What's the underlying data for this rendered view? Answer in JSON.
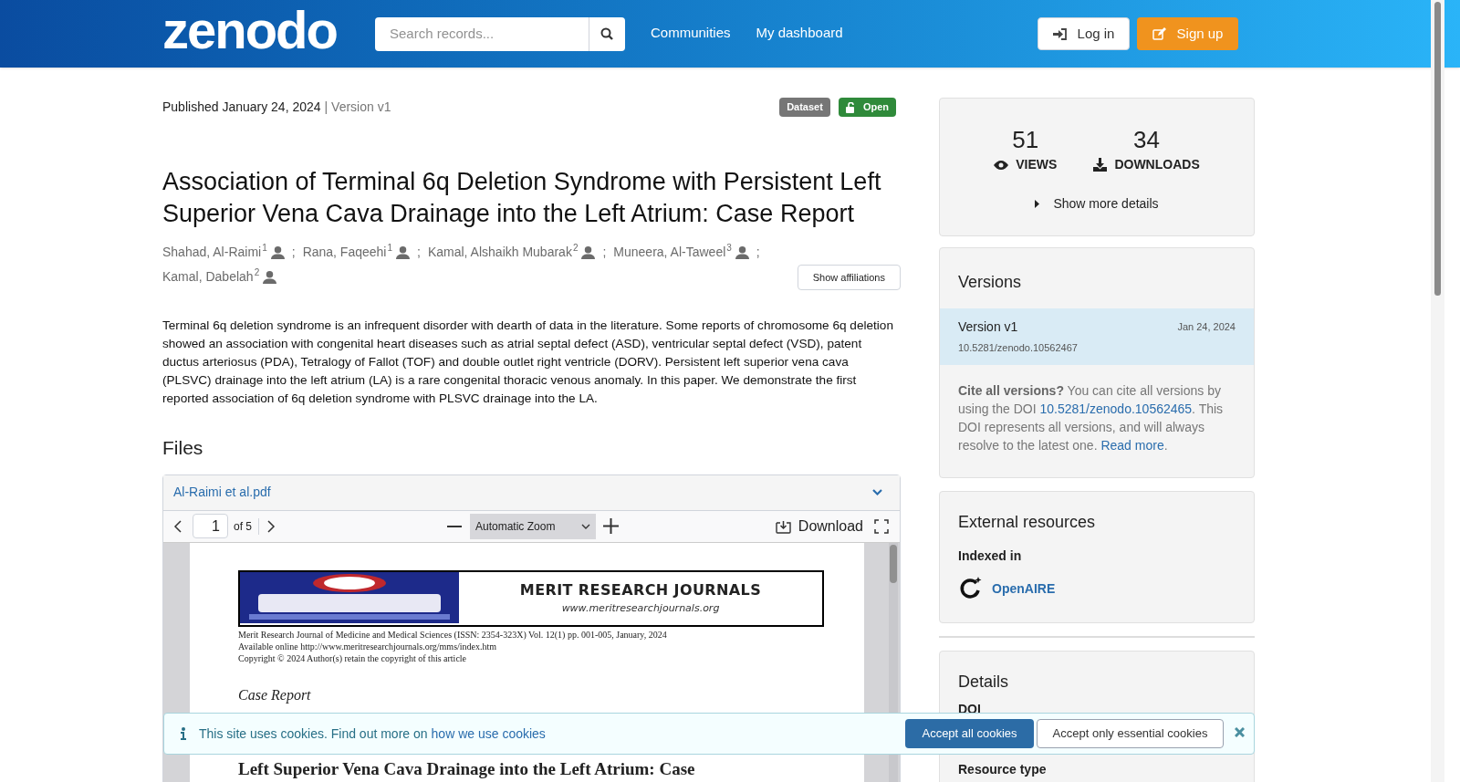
{
  "header": {
    "logo": "zenodo",
    "search": {
      "placeholder": "Search records..."
    },
    "nav": [
      "Communities",
      "My dashboard"
    ],
    "login": "Log in",
    "signup": "Sign up"
  },
  "record": {
    "published": "Published January 24, 2024",
    "version": "| Version v1",
    "badges": [
      {
        "label": "Dataset",
        "kind": "type"
      },
      {
        "label": "Open",
        "kind": "access"
      }
    ],
    "title": "Association of Terminal 6q Deletion Syndrome with Persistent Left Superior Vena Cava Drainage into the Left Atrium: Case Report",
    "authors": [
      {
        "name": "Shahad, Al-Raimi",
        "aff": "1"
      },
      {
        "name": "Rana, Faqeehi",
        "aff": "1"
      },
      {
        "name": "Kamal, Alshaikh Mubarak",
        "aff": "2"
      },
      {
        "name": "Muneera, Al-Taweel",
        "aff": "3"
      },
      {
        "name": "Kamal, Dabelah",
        "aff": "2"
      }
    ],
    "separator": ";",
    "show_affiliations": "Show affiliations",
    "abstract": "Terminal 6q deletion syndrome is an infrequent disorder with dearth of data in the literature. Some reports of chromosome 6q deletion showed an association with congenital heart diseases such as atrial septal defect (ASD), ventricular septal defect (VSD), patent ductus arteriosus (PDA), Tetralogy of Fallot (TOF) and double outlet right ventricle (DORV). Persistent left superior vena cava (PLSVC) drainage into the left atrium (LA) is a rare congenital thoracic venous anomaly. In this paper. We demonstrate the first reported association of 6q deletion syndrome with PLSVC drainage into the LA."
  },
  "files": {
    "heading": "Files",
    "filename": "Al-Raimi et al.pdf",
    "expanded": true,
    "viewer": {
      "page": "1",
      "of": "of 5",
      "zoom": "Automatic Zoom",
      "download": "Download",
      "document": {
        "banner_title": "MERIT RESEARCH JOURNALS",
        "banner_url": "www.meritresearchjournals.org",
        "lines": [
          "Merit Research Journal of Medicine and Medical Sciences (ISSN: 2354-323X) Vol. 12(1) pp. 001-005, January, 2024",
          "Available online http://www.meritresearchjournals.org/mms/index.htm",
          "Copyright © 2024 Author(s) retain the copyright of this article"
        ],
        "section": "Case Report",
        "heading_cut": "Left Superior Vena Cava Drainage into the Left Atrium: Case"
      }
    }
  },
  "stats": {
    "views": "51",
    "views_label": "VIEWS",
    "downloads": "34",
    "downloads_label": "DOWNLOADS",
    "more": "Show more details"
  },
  "versions": {
    "heading": "Versions",
    "items": [
      {
        "label": "Version v1",
        "date": "Jan 24, 2024",
        "doi": "10.5281/zenodo.10562467",
        "selected": true
      }
    ],
    "cite_bold": "Cite all versions?",
    "cite_text": "You can cite all versions by using the DOI",
    "cite_doi": "10.5281/zenodo.10562465",
    "cite_rest": ". This DOI represents all versions, and will always resolve to the latest one.",
    "read_more": "Read more",
    "period": "."
  },
  "external": {
    "heading": "External resources",
    "indexed": "Indexed in",
    "source": "OpenAIRE"
  },
  "details": {
    "heading": "Details",
    "fields": [
      "DOI",
      "Resource type"
    ]
  },
  "cookies": {
    "text": "This site uses cookies. Find out more on",
    "link": "how we use cookies",
    "accept_all": "Accept all cookies",
    "accept_essential": "Accept only essential cookies"
  }
}
